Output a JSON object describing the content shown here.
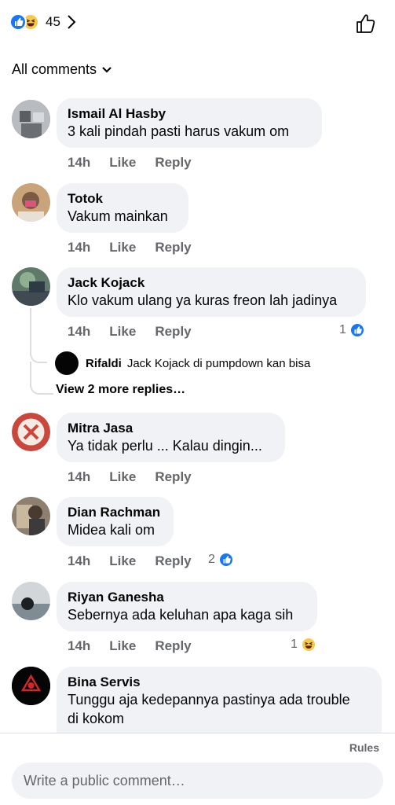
{
  "header": {
    "reaction_count": "45"
  },
  "filter": {
    "label": "All comments"
  },
  "comments": [
    {
      "author": "Ismail Al Hasby",
      "text": "3 kali pindah pasti  harus vakum om",
      "time": "14h",
      "like": "Like",
      "reply": "Reply"
    },
    {
      "author": "Totok",
      "text": "Vakum mainkan",
      "time": "14h",
      "like": "Like",
      "reply": "Reply"
    },
    {
      "author": "Jack Kojack",
      "text": "Klo vakum ulang ya kuras freon lah jadinya",
      "time": "14h",
      "like": "Like",
      "reply": "Reply",
      "reactions": "1",
      "reaction_icon": "like-icon"
    },
    {
      "author": "Mitra Jasa",
      "text": "Ya tidak perlu ... Kalau dingin...",
      "time": "14h",
      "like": "Like",
      "reply": "Reply"
    },
    {
      "author": "Dian Rachman",
      "text": "Midea kali om",
      "time": "14h",
      "like": "Like",
      "reply": "Reply",
      "reactions": "2",
      "reaction_icon": "like-icon"
    },
    {
      "author": "Riyan Ganesha",
      "text": "Sebernya ada keluhan apa kaga sih",
      "time": "14h",
      "like": "Like",
      "reply": "Reply",
      "reactions": "1",
      "reaction_icon": "haha-icon"
    },
    {
      "author": "Bina Servis",
      "text_line1": "Tunggu aja kedepannya pastinya ada trouble",
      "text_line2": "di kokom"
    }
  ],
  "reply_preview": {
    "author": "Rifaldi",
    "text": "Jack Kojack di pumpdown kan bisa",
    "more": "View 2 more replies…"
  },
  "footer": {
    "rules": "Rules",
    "input_placeholder": "Write a public comment…"
  },
  "colors": {
    "like_blue": "#1877f2",
    "bubble_bg": "#f0f2f5",
    "meta_gray": "#65676b"
  }
}
